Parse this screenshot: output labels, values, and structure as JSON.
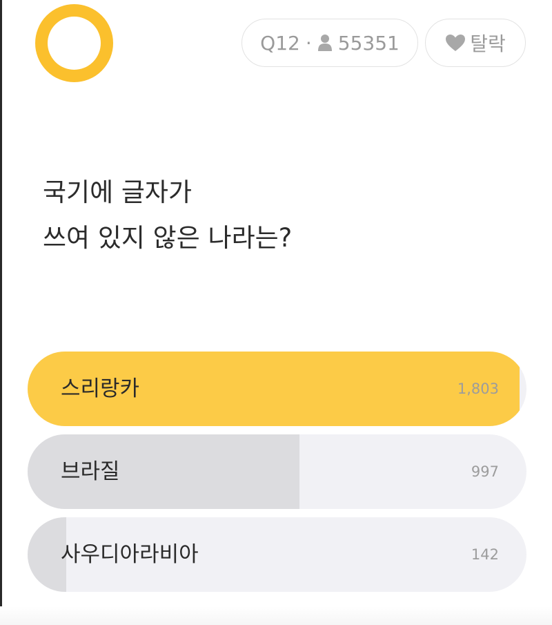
{
  "header": {
    "question_number": "Q12",
    "separator": "·",
    "participant_count": "55351",
    "drop_label": "탈락",
    "user_icon": "user-icon",
    "heart_icon": "heart-icon"
  },
  "question": {
    "line1": "국기에 글자가",
    "line2": "쓰여 있지 않은 나라는?"
  },
  "options": [
    {
      "label": "스리랑카",
      "count": "1,803",
      "value": 1803,
      "highlight": true
    },
    {
      "label": "브라질",
      "count": "997",
      "value": 997,
      "highlight": false
    },
    {
      "label": "사우디아라비아",
      "count": "142",
      "value": 142,
      "highlight": false
    }
  ],
  "colors": {
    "accent": "#fbc02d",
    "winner_fill": "#fccb47",
    "other_fill": "#dcdcdf",
    "track": "#f1f1f5"
  }
}
